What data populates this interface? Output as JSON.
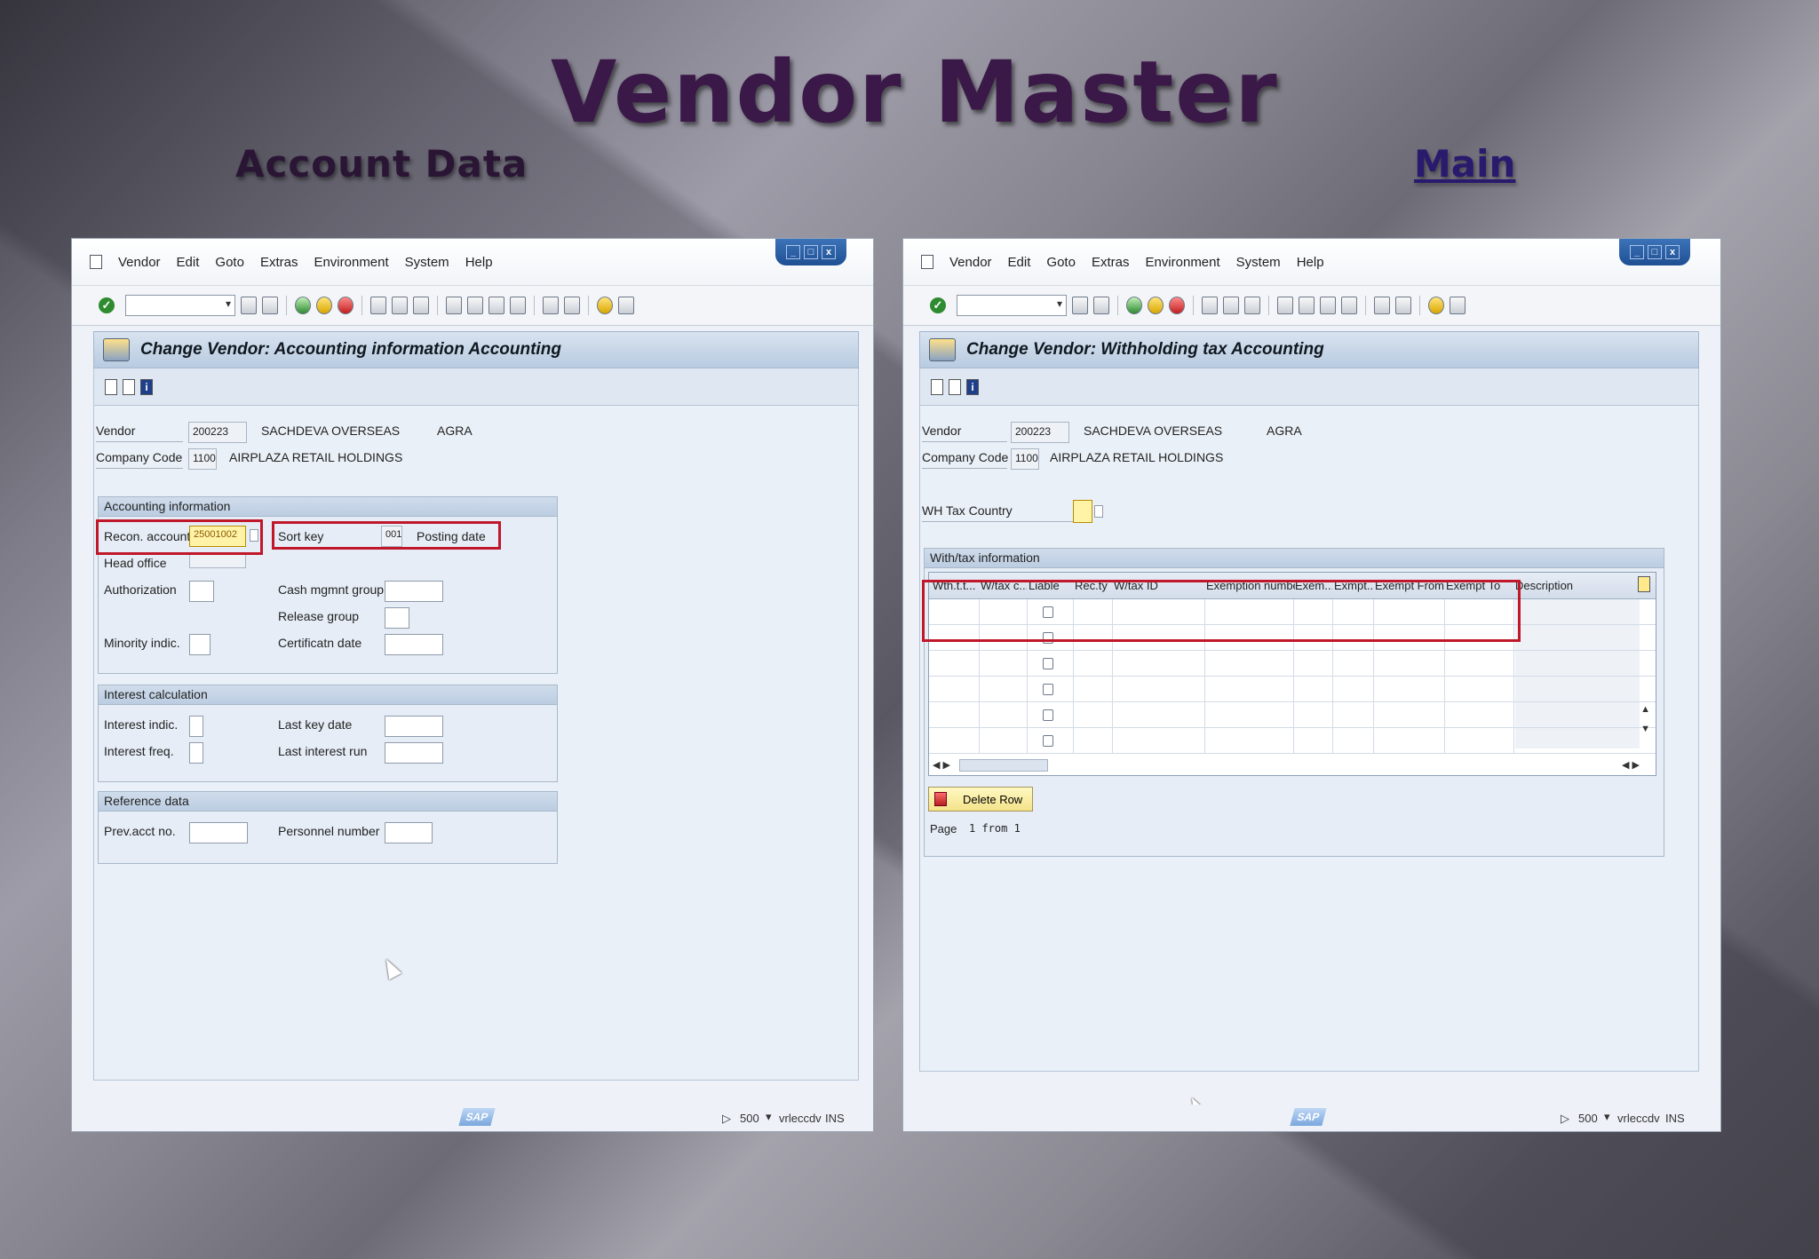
{
  "slide": {
    "title": "Vendor Master",
    "subtitle_left": "Account Data",
    "subtitle_right_link": "Main"
  },
  "colors": {
    "title": "#3a1848",
    "highlight_box": "#c0182a",
    "sap_title_bar": "#b8cbe0"
  },
  "menu": [
    "Vendor",
    "Edit",
    "Goto",
    "Extras",
    "Environment",
    "System",
    "Help"
  ],
  "left_window": {
    "screen_title": "Change Vendor: Accounting information Accounting",
    "vendor_label": "Vendor",
    "vendor_value": "200223",
    "vendor_name": "SACHDEVA OVERSEAS",
    "vendor_city": "AGRA",
    "company_code_label": "Company Code",
    "company_code_value": "1100",
    "company_name": "AIRPLAZA RETAIL HOLDINGS",
    "accounting_group": {
      "title": "Accounting information",
      "recon_label": "Recon. account",
      "recon_value": "25001002",
      "sort_key_label": "Sort key",
      "sort_key_value": "001",
      "sort_key_text": "Posting date",
      "head_office_label": "Head office",
      "authorization_label": "Authorization",
      "cash_mgmt_label": "Cash mgmnt group",
      "release_group_label": "Release group",
      "minority_label": "Minority indic.",
      "certificatn_label": "Certificatn date"
    },
    "interest_group": {
      "title": "Interest calculation",
      "interest_indic_label": "Interest indic.",
      "last_key_date_label": "Last key date",
      "interest_freq_label": "Interest freq.",
      "last_interest_run_label": "Last interest run"
    },
    "reference_group": {
      "title": "Reference data",
      "prev_acct_label": "Prev.acct no.",
      "personnel_label": "Personnel number"
    },
    "status": {
      "client": "500",
      "server": "vrleccdv",
      "mode": "INS"
    }
  },
  "right_window": {
    "screen_title": "Change Vendor: Withholding tax Accounting",
    "vendor_label": "Vendor",
    "vendor_value": "200223",
    "vendor_name": "SACHDEVA OVERSEAS",
    "vendor_city": "AGRA",
    "company_code_label": "Company Code",
    "company_code_value": "1100",
    "company_name": "AIRPLAZA RETAIL HOLDINGS",
    "wh_tax_country_label": "WH Tax Country",
    "group_title": "With/tax information",
    "table_headers": [
      "Wth.t.t...",
      "W/tax c...",
      "Liable",
      "Rec.ty",
      "W/tax ID",
      "Exemption number",
      "Exem...",
      "Exmpt...",
      "Exempt From",
      "Exempt To",
      "Description"
    ],
    "delete_row_label": "Delete Row",
    "page_label": "Page",
    "page_value": "1 from 1",
    "status": {
      "client": "500",
      "server": "vrleccdv",
      "mode": "INS"
    },
    "sap_logo_text": "SAP"
  }
}
